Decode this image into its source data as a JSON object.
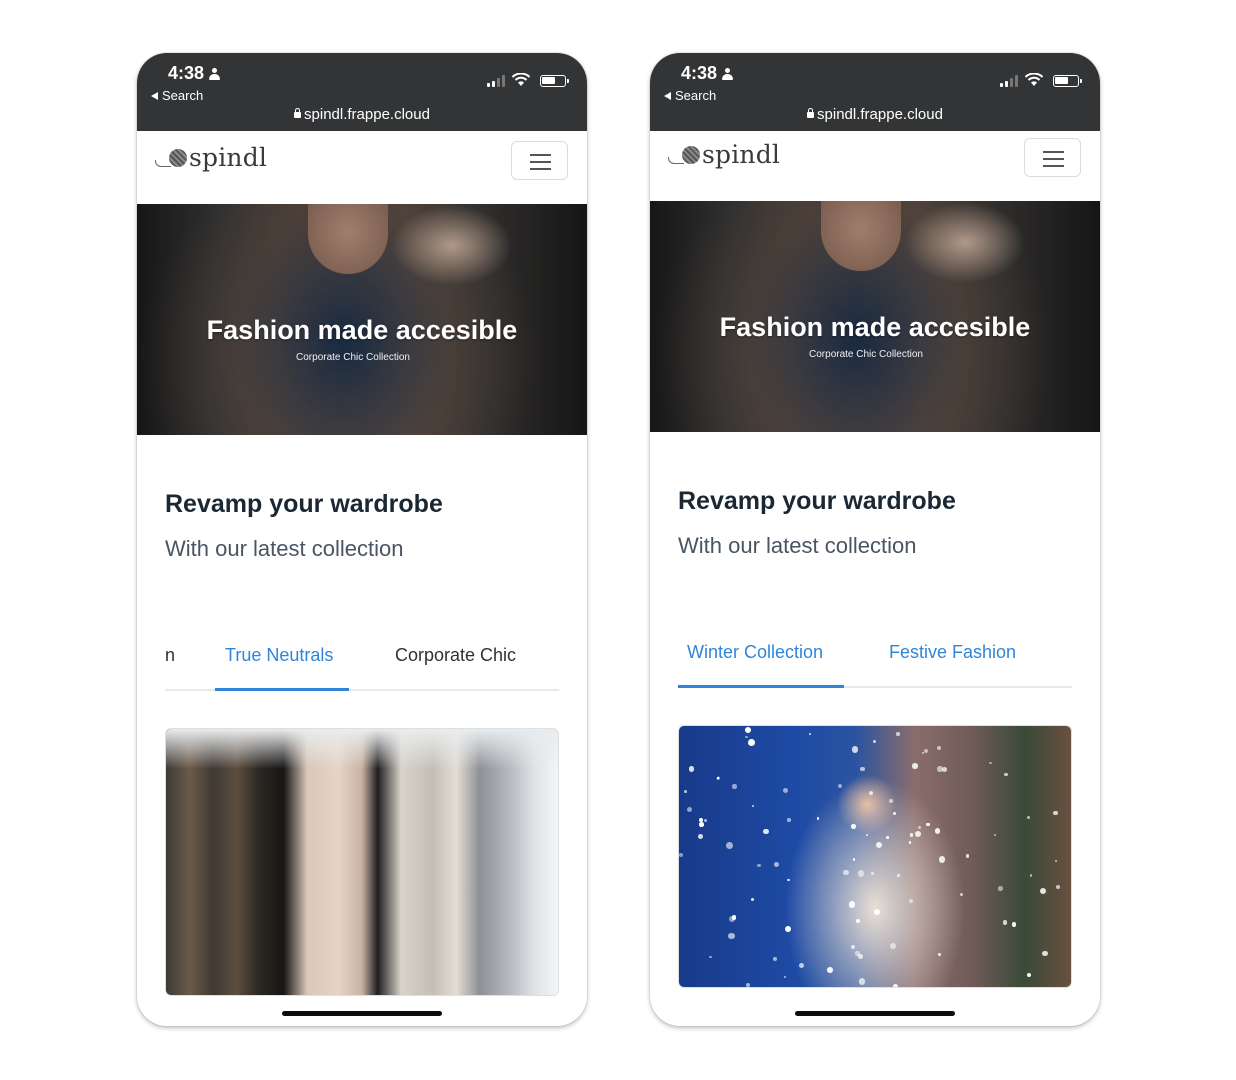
{
  "phones": [
    {
      "status": {
        "time": "4:38",
        "back_label": "Search",
        "url": "spindl.frappe.cloud"
      },
      "navbar": {
        "logo_text": "spindl",
        "menu_icon": "hamburger-icon"
      },
      "hero": {
        "title": "Fashion made accesible",
        "subtitle": "Corporate Chic Collection"
      },
      "section": {
        "title": "Revamp your wardrobe",
        "subtitle": "With our latest collection"
      },
      "tabs": [
        {
          "label": "n",
          "active": false
        },
        {
          "label": "True Neutrals",
          "active": true
        },
        {
          "label": "Corporate Chic",
          "active": false
        }
      ],
      "card_image": "clothes-on-rack-image"
    },
    {
      "status": {
        "time": "4:38",
        "back_label": "Search",
        "url": "spindl.frappe.cloud"
      },
      "navbar": {
        "logo_text": "spindl",
        "menu_icon": "hamburger-icon"
      },
      "hero": {
        "title": "Fashion made accesible",
        "subtitle": "Corporate Chic Collection"
      },
      "section": {
        "title": "Revamp your wardrobe",
        "subtitle": "With our latest collection"
      },
      "tabs": [
        {
          "label": "Winter Collection",
          "active": true
        },
        {
          "label": "Festive Fashion",
          "active": false
        }
      ],
      "card_image": "winter-woman-snow-image"
    }
  ],
  "colors": {
    "accent": "#2f85d9",
    "statusbar": "#323436",
    "heading": "#1b2733"
  }
}
